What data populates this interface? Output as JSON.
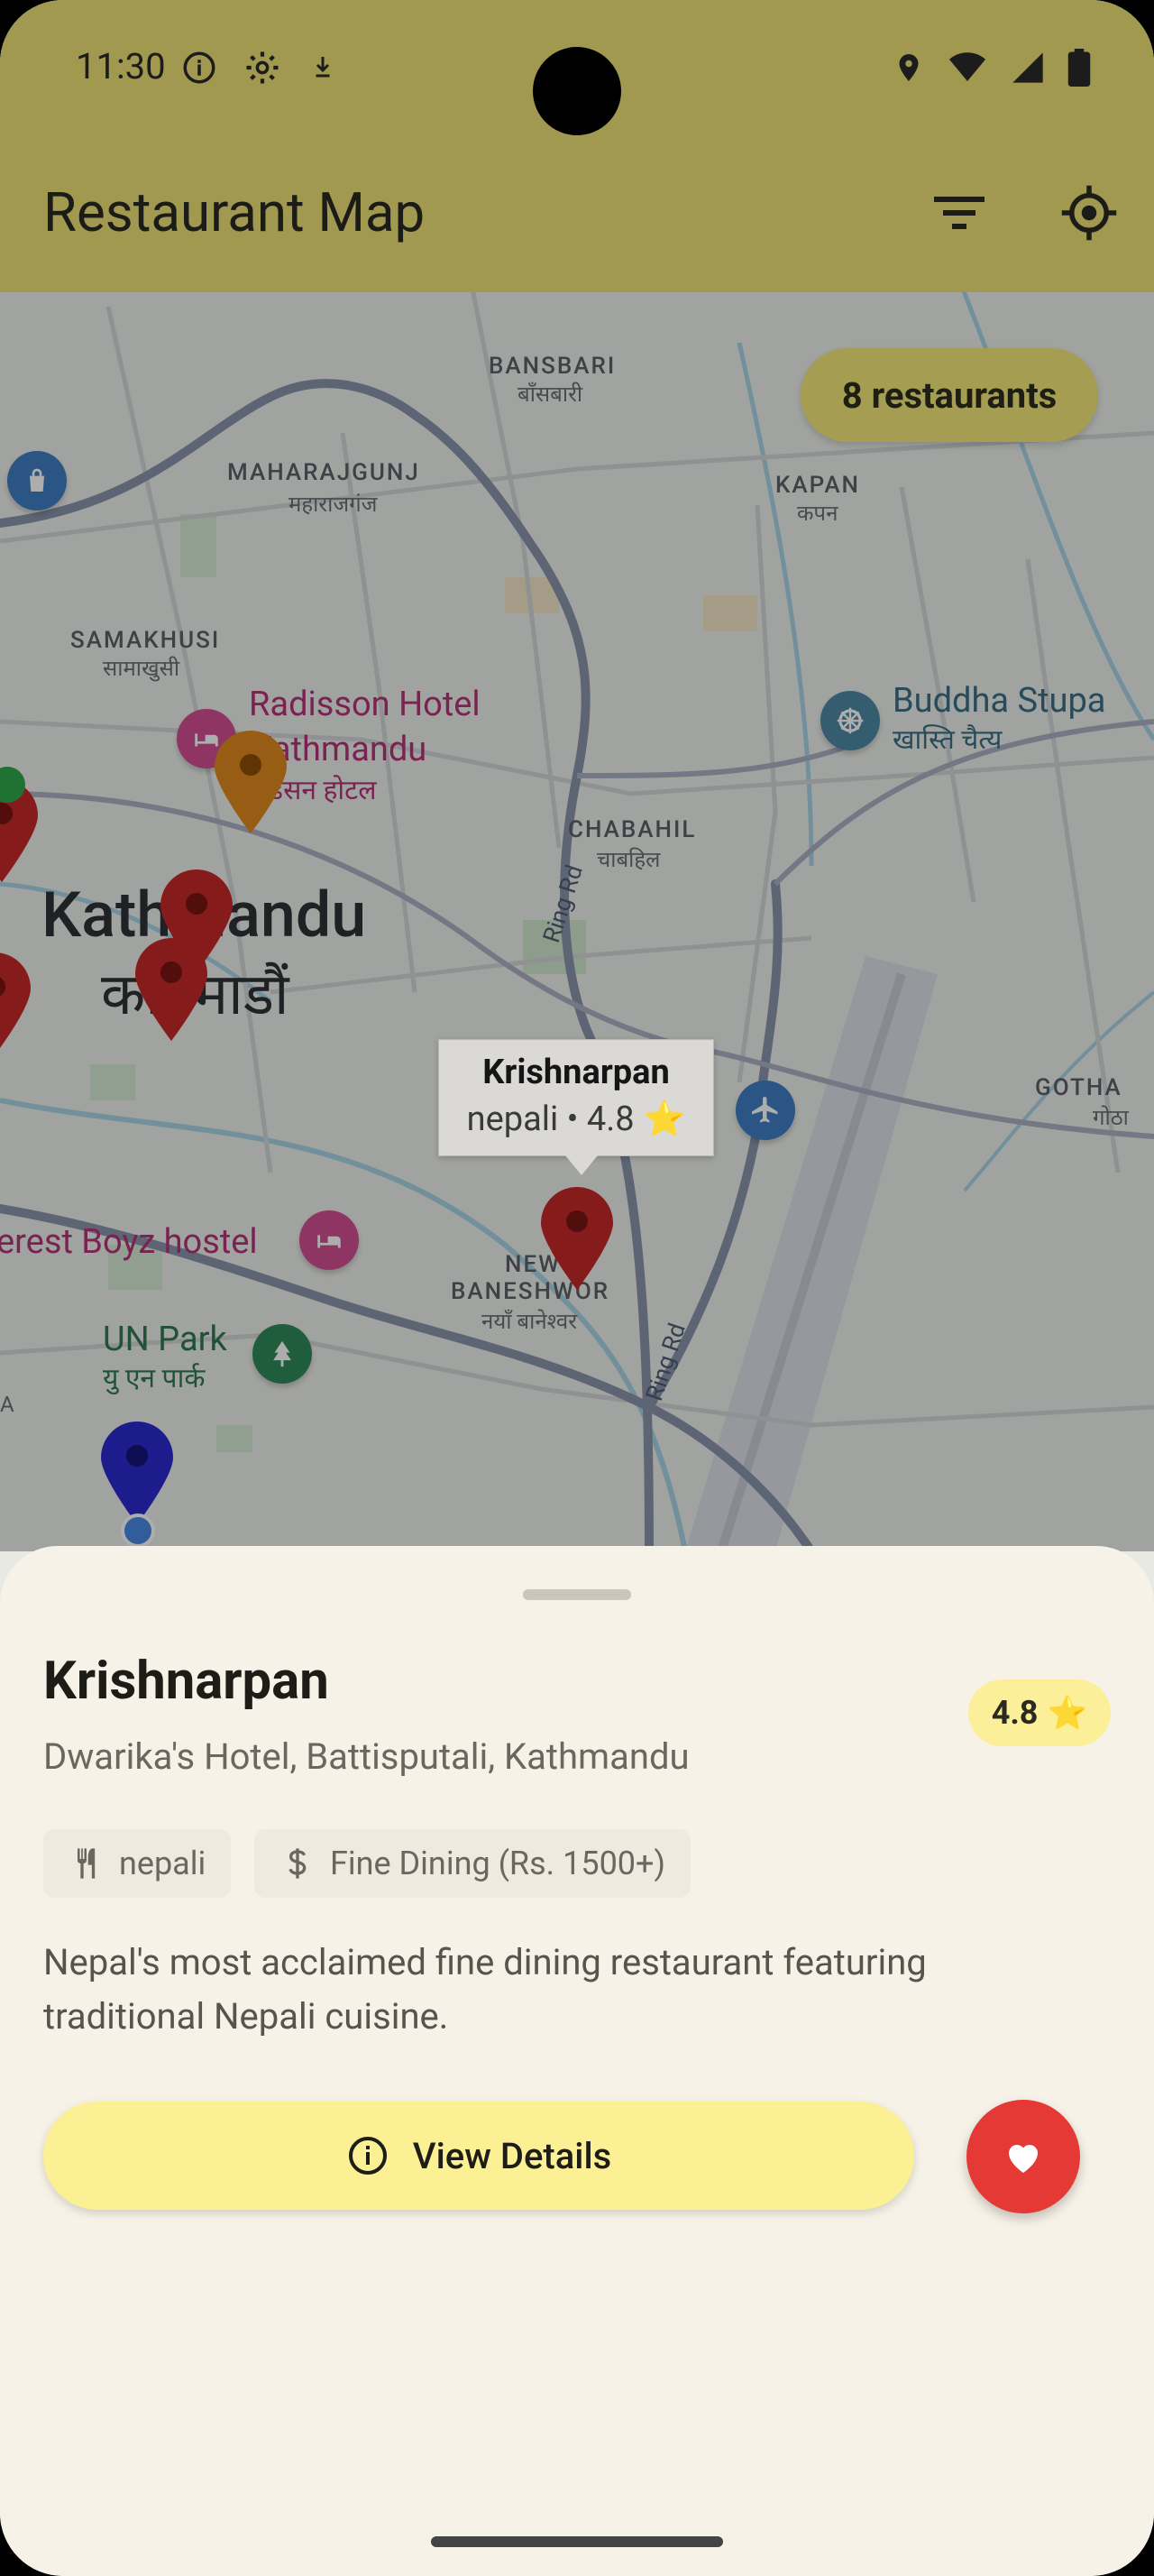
{
  "status_bar": {
    "time": "11:30"
  },
  "app_bar": {
    "title": "Restaurant Map"
  },
  "map": {
    "restaurant_count": "8 restaurants",
    "labels": {
      "bansbari": "BANSBARI",
      "bansbari_np": "बाँसबारी",
      "maharajgunj": "MAHARAJGUNJ",
      "maharajgunj_np": "महाराजगंज",
      "kapan": "KAPAN",
      "kapan_np": "कपन",
      "samakhusi": "SAMAKHUSI",
      "samakhusi_np": "सामाखुसी",
      "radisson_1": "Radisson Hotel",
      "radisson_2": "Kathmandu",
      "radisson_np": "रेडिसन होटल",
      "buddha_stupa": "Buddha Stupa",
      "buddha_stupa_np": "खास्ति चैत्य",
      "chabahil": "CHABAHIL",
      "chabahil_np": "चाबहिल",
      "kathmandu": "Kathmandu",
      "kathmandu_np": "काठमाडौं",
      "ring_rd_1": "Ring Rd",
      "ring_rd_2": "Ring Rd",
      "gothatar": "GOTHA",
      "gothatar_np": "गोठा",
      "new_baneshwor_1": "NEW",
      "new_baneshwor_2": "BANESHWOR",
      "new_baneshwor_np": "नयाँ बानेश्वर",
      "hostel": "erest Boyz hostel",
      "un_park": "UN Park",
      "un_park_np": "यु एन पार्क",
      "edge_a": "A"
    },
    "tooltip": {
      "title": "Krishnarpan",
      "subtitle": "nepali • 4.8 ⭐"
    }
  },
  "restaurant": {
    "name": "Krishnarpan",
    "rating": "4.8",
    "rating_icon": "⭐",
    "address": "Dwarika's Hotel, Battisputali, Kathmandu",
    "cuisine": "nepali",
    "price": "Fine Dining (Rs. 1500+)",
    "description": "Nepal's most acclaimed fine dining restaurant featuring traditional Nepali cuisine.",
    "details_label": "View Details"
  },
  "colors": {
    "app_bar": "#a19950",
    "pin_red": "#c62828",
    "pin_orange": "#e08a1e",
    "pin_blue": "#2a2ad0",
    "favorite": "#e53935",
    "details_button": "#fcf095"
  }
}
